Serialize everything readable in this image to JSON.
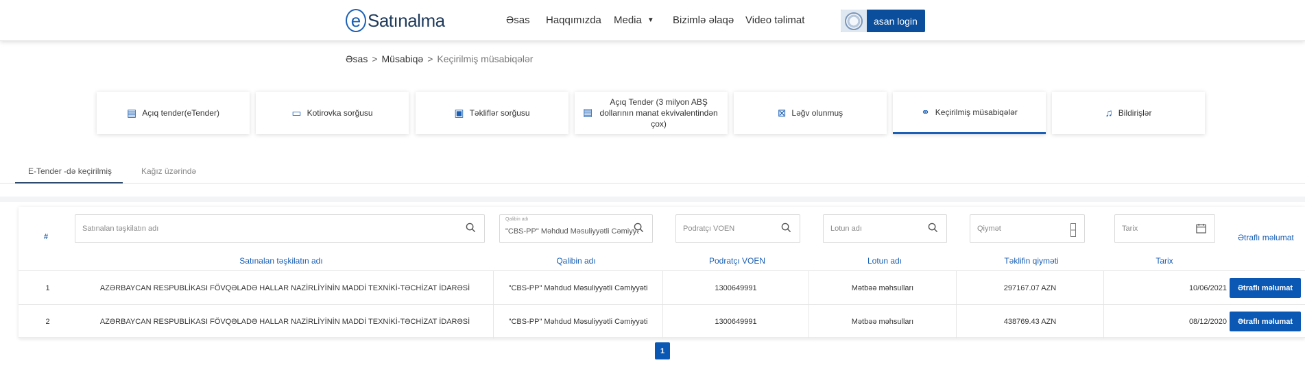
{
  "header": {
    "logo_letter": "e",
    "logo_text": "Satınalma",
    "nav": [
      "Əsas",
      "Haqqımızda",
      "Media",
      "Bizimlə əlaqə",
      "Video təlimat"
    ],
    "login_label": "asan login"
  },
  "breadcrumb": {
    "home": "Əsas",
    "section": "Müsabiqə",
    "current": "Keçirilmiş müsabiqələr",
    "sep": ">"
  },
  "cards": [
    {
      "label": "Açıq tender(eTender)",
      "icon": "document-icon"
    },
    {
      "label": "Kotirovka sorğusu",
      "icon": "message-icon"
    },
    {
      "label": "Təkliflər sorğusu",
      "icon": "chat-icon"
    },
    {
      "label": "Açıq Tender (3 milyon ABŞ dollarının manat ekvivalentindən çox)",
      "icon": "document-icon"
    },
    {
      "label": "Ləğv olunmuş",
      "icon": "cancel-icon"
    },
    {
      "label": "Keçirilmiş müsabiqələr",
      "icon": "link-icon"
    },
    {
      "label": "Bildirişlər",
      "icon": "bell-icon"
    }
  ],
  "tabs": [
    "E-Tender -də keçirilmiş",
    "Kağız üzərində"
  ],
  "filters": {
    "hash": "#",
    "org_placeholder": "Satınalan təşkilatın adı",
    "winner_label": "Qalibin adı",
    "winner_value": "\"CBS-PP\" Məhdud Məsuliyyətli Cəmiyyəti",
    "voen_placeholder": "Podratçı VOEN",
    "lot_placeholder": "Lotun adı",
    "price_placeholder": "Qiymət",
    "date_placeholder": "Tarix",
    "details_header": "Ətraflı məlumat"
  },
  "columns": [
    "Satınalan təşkilatın adı",
    "Qalibin adı",
    "Podratçı VOEN",
    "Lotun adı",
    "Təklifin qiyməti",
    "Tarix"
  ],
  "rows": [
    {
      "num": "1",
      "org": "AZƏRBAYCAN RESPUBLİKASI FÖVQƏLADƏ HALLAR NAZİRLİYİNİN MADDİ TEXNİKİ-TƏCHİZAT İDARƏSİ",
      "winner": "\"CBS-PP\" Məhdud Məsuliyyətli Cəmiyyəti",
      "voen": "1300649991",
      "lot": "Mətbəə məhsulları",
      "price": "297167.07 AZN",
      "date": "10/06/2021",
      "button": "Ətraflı məlumat"
    },
    {
      "num": "2",
      "org": "AZƏRBAYCAN RESPUBLİKASI FÖVQƏLADƏ HALLAR NAZİRLİYİNİN MADDİ TEXNİKİ-TƏCHİZAT İDARƏSİ",
      "winner": "\"CBS-PP\" Məhdud Məsuliyyətli Cəmiyyəti",
      "voen": "1300649991",
      "lot": "Mətbəə məhsulları",
      "price": "438769.43 AZN",
      "date": "08/12/2020",
      "button": "Ətraflı məlumat"
    }
  ],
  "pagination": {
    "current": "1"
  },
  "colors": {
    "accent": "#1a5fb4",
    "button": "#0b58b4",
    "header_shadow": "#e3e3e3"
  }
}
